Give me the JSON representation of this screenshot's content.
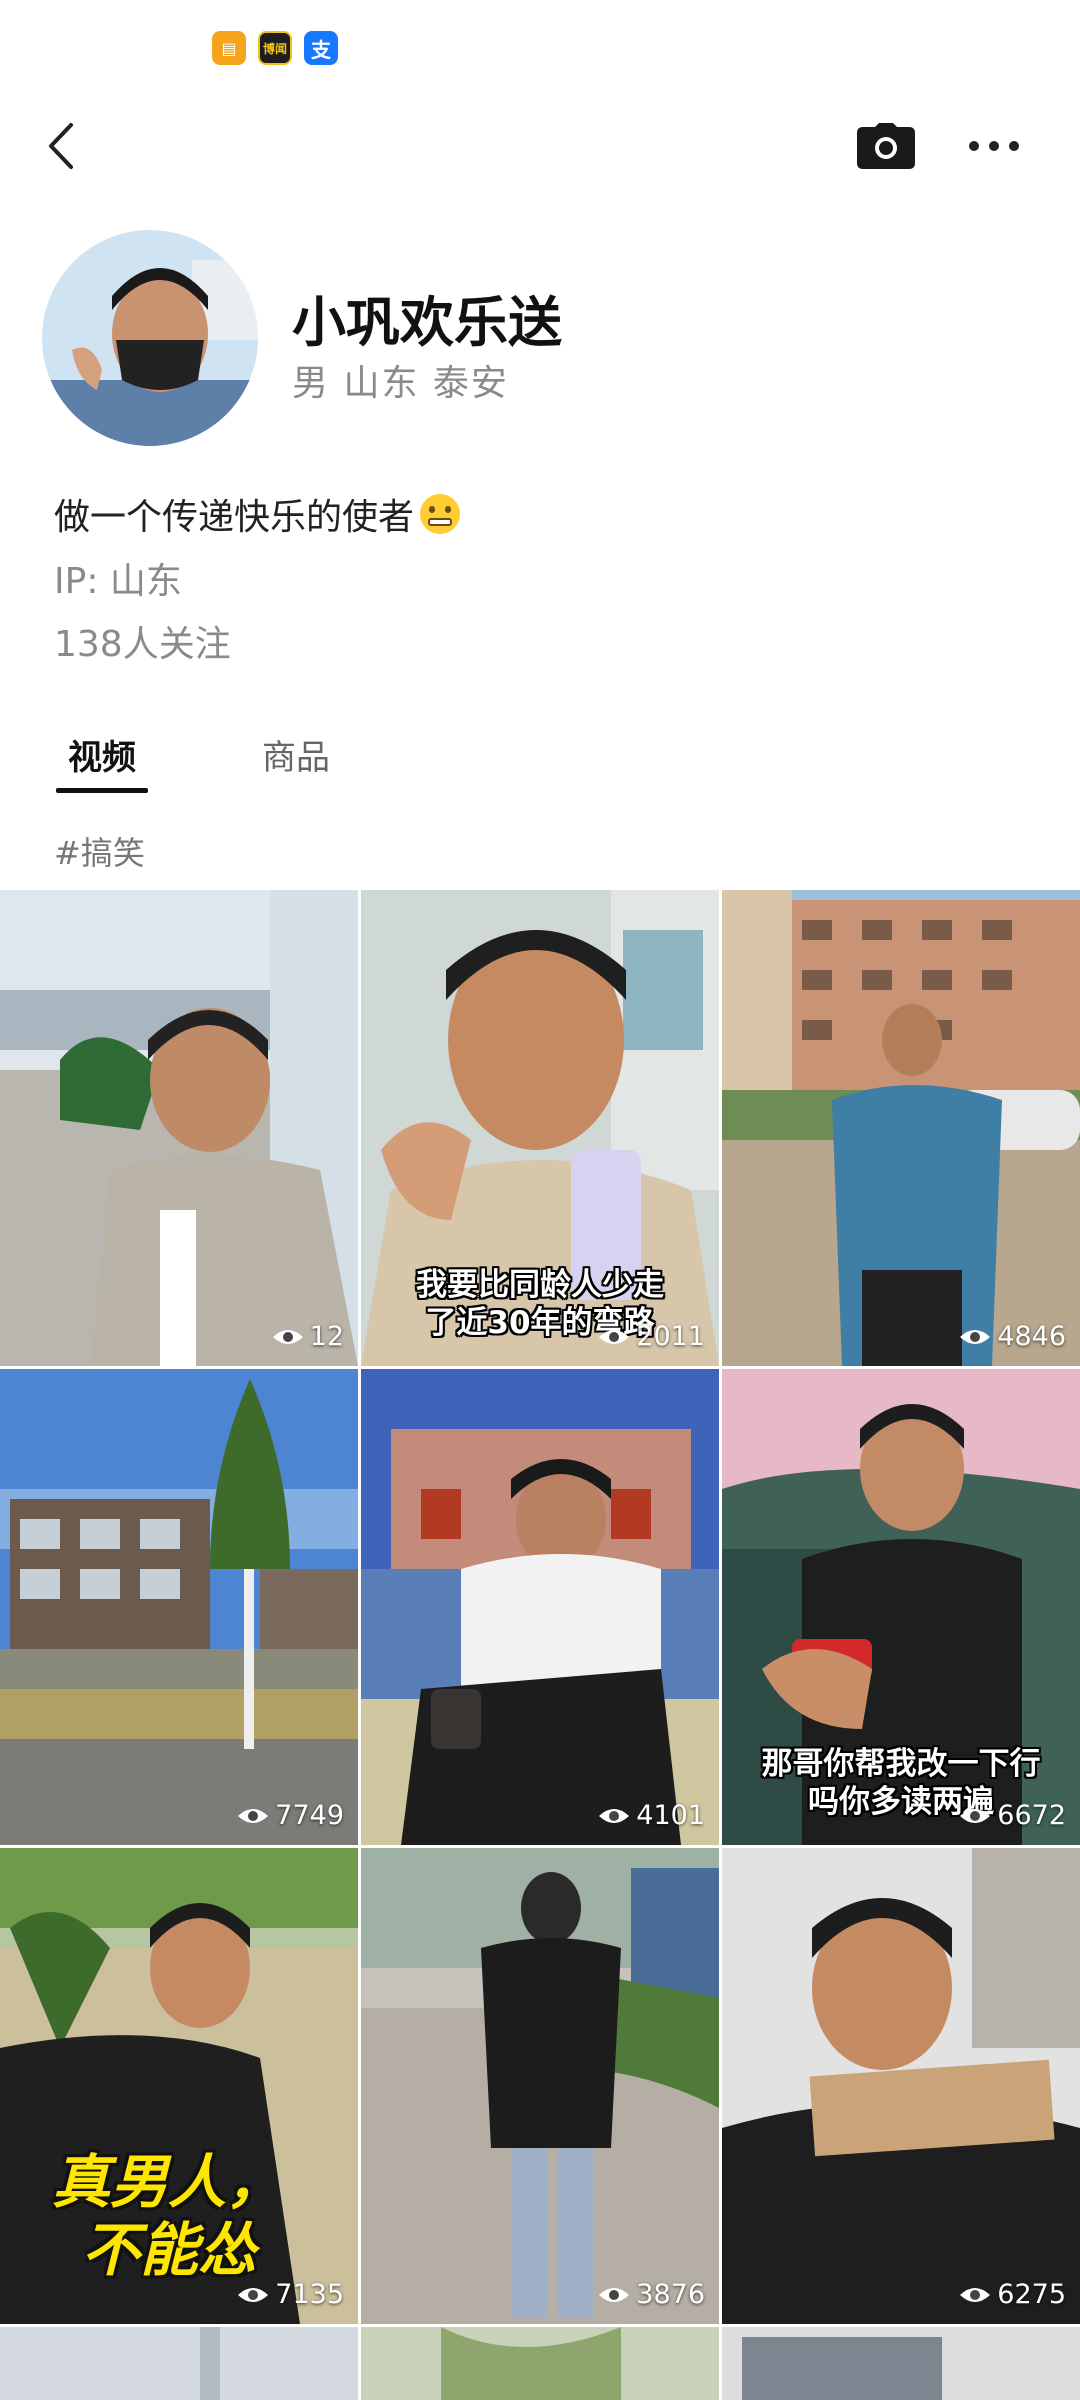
{
  "status_icons": [
    {
      "name": "notes-icon",
      "glyph": "▤"
    },
    {
      "name": "boke-app-icon",
      "glyph": "博闻"
    },
    {
      "name": "alipay-icon",
      "glyph": "支"
    }
  ],
  "header": {
    "back_icon": "chevron-left-icon",
    "camera_icon": "camera-icon",
    "more_icon": "more-dots-icon"
  },
  "profile": {
    "name": "小巩欢乐送",
    "meta": "男  山东  泰安",
    "bio": "做一个传递快乐的使者",
    "ip": "IP: 山东",
    "following": "138人关注"
  },
  "tabs": [
    {
      "label": "视频",
      "active": true
    },
    {
      "label": "商品",
      "active": false
    }
  ],
  "hashtag": "#搞笑",
  "videos": [
    {
      "views": "12",
      "caption": ""
    },
    {
      "views": "2011",
      "caption_lines": [
        "我要比同龄人少走",
        "了近30年的弯路"
      ]
    },
    {
      "views": "4846",
      "caption": ""
    },
    {
      "views": "7749",
      "caption": ""
    },
    {
      "views": "4101",
      "caption": ""
    },
    {
      "views": "6672",
      "caption_lines": [
        "那哥你帮我改一下行",
        "吗你多读两遍"
      ]
    },
    {
      "views": "7135",
      "big_caption_lines": [
        "真男人，",
        "不能怂"
      ]
    },
    {
      "views": "3876",
      "caption": ""
    },
    {
      "views": "6275",
      "caption": ""
    }
  ],
  "colors": {
    "accent_text": "#111111",
    "secondary_text": "#8a8a8a",
    "tab_underline": "#111111"
  }
}
